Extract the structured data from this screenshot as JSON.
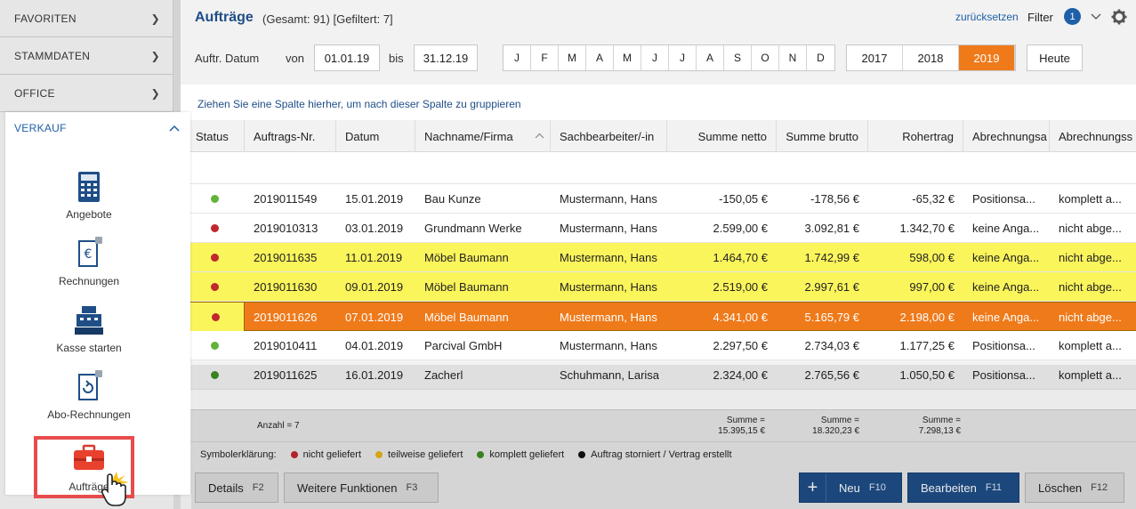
{
  "sidebar": {
    "sections": [
      {
        "label": "FAVORITEN"
      },
      {
        "label": "STAMMDATEN"
      },
      {
        "label": "OFFICE"
      }
    ],
    "active_section": "VERKAUF",
    "items": [
      {
        "label": "Angebote",
        "icon": "calculator-icon"
      },
      {
        "label": "Rechnungen",
        "icon": "euro-document-icon"
      },
      {
        "label": "Kasse starten",
        "icon": "cash-register-icon"
      },
      {
        "label": "Abo-Rechnungen",
        "icon": "recurring-document-icon"
      },
      {
        "label": "Aufträge",
        "icon": "briefcase-icon"
      }
    ]
  },
  "header": {
    "title": "Aufträge",
    "subtitle": "(Gesamt: 91) [Gefiltert: 7]",
    "reset_label": "zurücksetzen",
    "filter_label": "Filter",
    "filter_count": "1"
  },
  "datefilter": {
    "label": "Auftr. Datum",
    "from_label": "von",
    "from_value": "01.01.19",
    "to_label": "bis",
    "to_value": "31.12.19",
    "months": [
      "J",
      "F",
      "M",
      "A",
      "M",
      "J",
      "J",
      "A",
      "S",
      "O",
      "N",
      "D"
    ],
    "years": [
      "2017",
      "2018",
      "2019"
    ],
    "active_year": "2019",
    "today_label": "Heute"
  },
  "groupbar": {
    "hint": "Ziehen Sie eine Spalte hierher, um nach dieser Spalte zu gruppieren"
  },
  "table": {
    "columns": [
      "Status",
      "Auftrags-Nr.",
      "Datum",
      "Nachname/Firma",
      "Sachbearbeiter/-in",
      "Summe netto",
      "Summe brutto",
      "Rohertrag",
      "Abrechnungsa",
      "Abrechnungss"
    ],
    "rows": [
      {
        "status": "#62b33a",
        "nr": "2019011549",
        "datum": "15.01.2019",
        "firma": "Bau Kunze",
        "bearbeiter": "Mustermann, Hans",
        "netto": "-150,05 €",
        "brutto": "-178,56 €",
        "rohertrag": "-65,32 €",
        "abr1": "Positionsa...",
        "abr2": "komplett a..."
      },
      {
        "status": "#c0282d",
        "nr": "2019010313",
        "datum": "03.01.2019",
        "firma": "Grundmann Werke",
        "bearbeiter": "Mustermann, Hans",
        "netto": "2.599,00 €",
        "brutto": "3.092,81 €",
        "rohertrag": "1.342,70 €",
        "abr1": "keine Anga...",
        "abr2": "nicht abge..."
      },
      {
        "status": "#c0282d",
        "nr": "2019011635",
        "datum": "11.01.2019",
        "firma": "Möbel Baumann",
        "bearbeiter": "Mustermann, Hans",
        "netto": "1.464,70 €",
        "brutto": "1.742,99 €",
        "rohertrag": "598,00 €",
        "abr1": "keine Anga...",
        "abr2": "nicht abge..."
      },
      {
        "status": "#c0282d",
        "nr": "2019011630",
        "datum": "09.01.2019",
        "firma": "Möbel Baumann",
        "bearbeiter": "Mustermann, Hans",
        "netto": "2.519,00 €",
        "brutto": "2.997,61 €",
        "rohertrag": "997,00 €",
        "abr1": "keine Anga...",
        "abr2": "nicht abge..."
      },
      {
        "status": "#c0282d",
        "nr": "2019011626",
        "datum": "07.01.2019",
        "firma": "Möbel Baumann",
        "bearbeiter": "Mustermann, Hans",
        "netto": "4.341,00 €",
        "brutto": "5.165,79 €",
        "rohertrag": "2.198,00 €",
        "abr1": "keine Anga...",
        "abr2": "nicht abge..."
      },
      {
        "status": "#62b33a",
        "nr": "2019010411",
        "datum": "04.01.2019",
        "firma": "Parcival GmbH",
        "bearbeiter": "Mustermann, Hans",
        "netto": "2.297,50 €",
        "brutto": "2.734,03 €",
        "rohertrag": "1.177,25 €",
        "abr1": "Positionsa...",
        "abr2": "komplett a..."
      },
      {
        "status": "#3d8f22",
        "nr": "2019011625",
        "datum": "16.01.2019",
        "firma": "Zacherl",
        "bearbeiter": "Schuhmann, Larisa",
        "netto": "2.324,00 €",
        "brutto": "2.765,56 €",
        "rohertrag": "1.050,50 €",
        "abr1": "Positionsa...",
        "abr2": "komplett a..."
      }
    ]
  },
  "summary": {
    "count": "Anzahl = 7",
    "sum_label": "Summe =",
    "netto": "15.395,15 €",
    "brutto": "18.320,23 €",
    "rohertrag": "7.298,13 €"
  },
  "legend": {
    "label": "Symbolerklärung:",
    "items": [
      {
        "text": "nicht geliefert",
        "color": "#c0282d"
      },
      {
        "text": "teilweise geliefert",
        "color": "#e8b21a"
      },
      {
        "text": "komplett geliefert",
        "color": "#3d8f22"
      },
      {
        "text": "Auftrag storniert / Vertrag erstellt",
        "color": "#111111"
      }
    ]
  },
  "buttons": {
    "details": "Details",
    "details_key": "F2",
    "weitere": "Weitere Funktionen",
    "weitere_key": "F3",
    "neu": "Neu",
    "neu_key": "F10",
    "bearbeiten": "Bearbeiten",
    "bearbeiten_key": "F11",
    "loeschen": "Löschen",
    "loeschen_key": "F12"
  },
  "colors": {
    "accent": "#1f4e87",
    "active_orange": "#ef7a1a",
    "highlight_yellow": "#fbf55c",
    "selected_row": "#ef7a1a"
  }
}
